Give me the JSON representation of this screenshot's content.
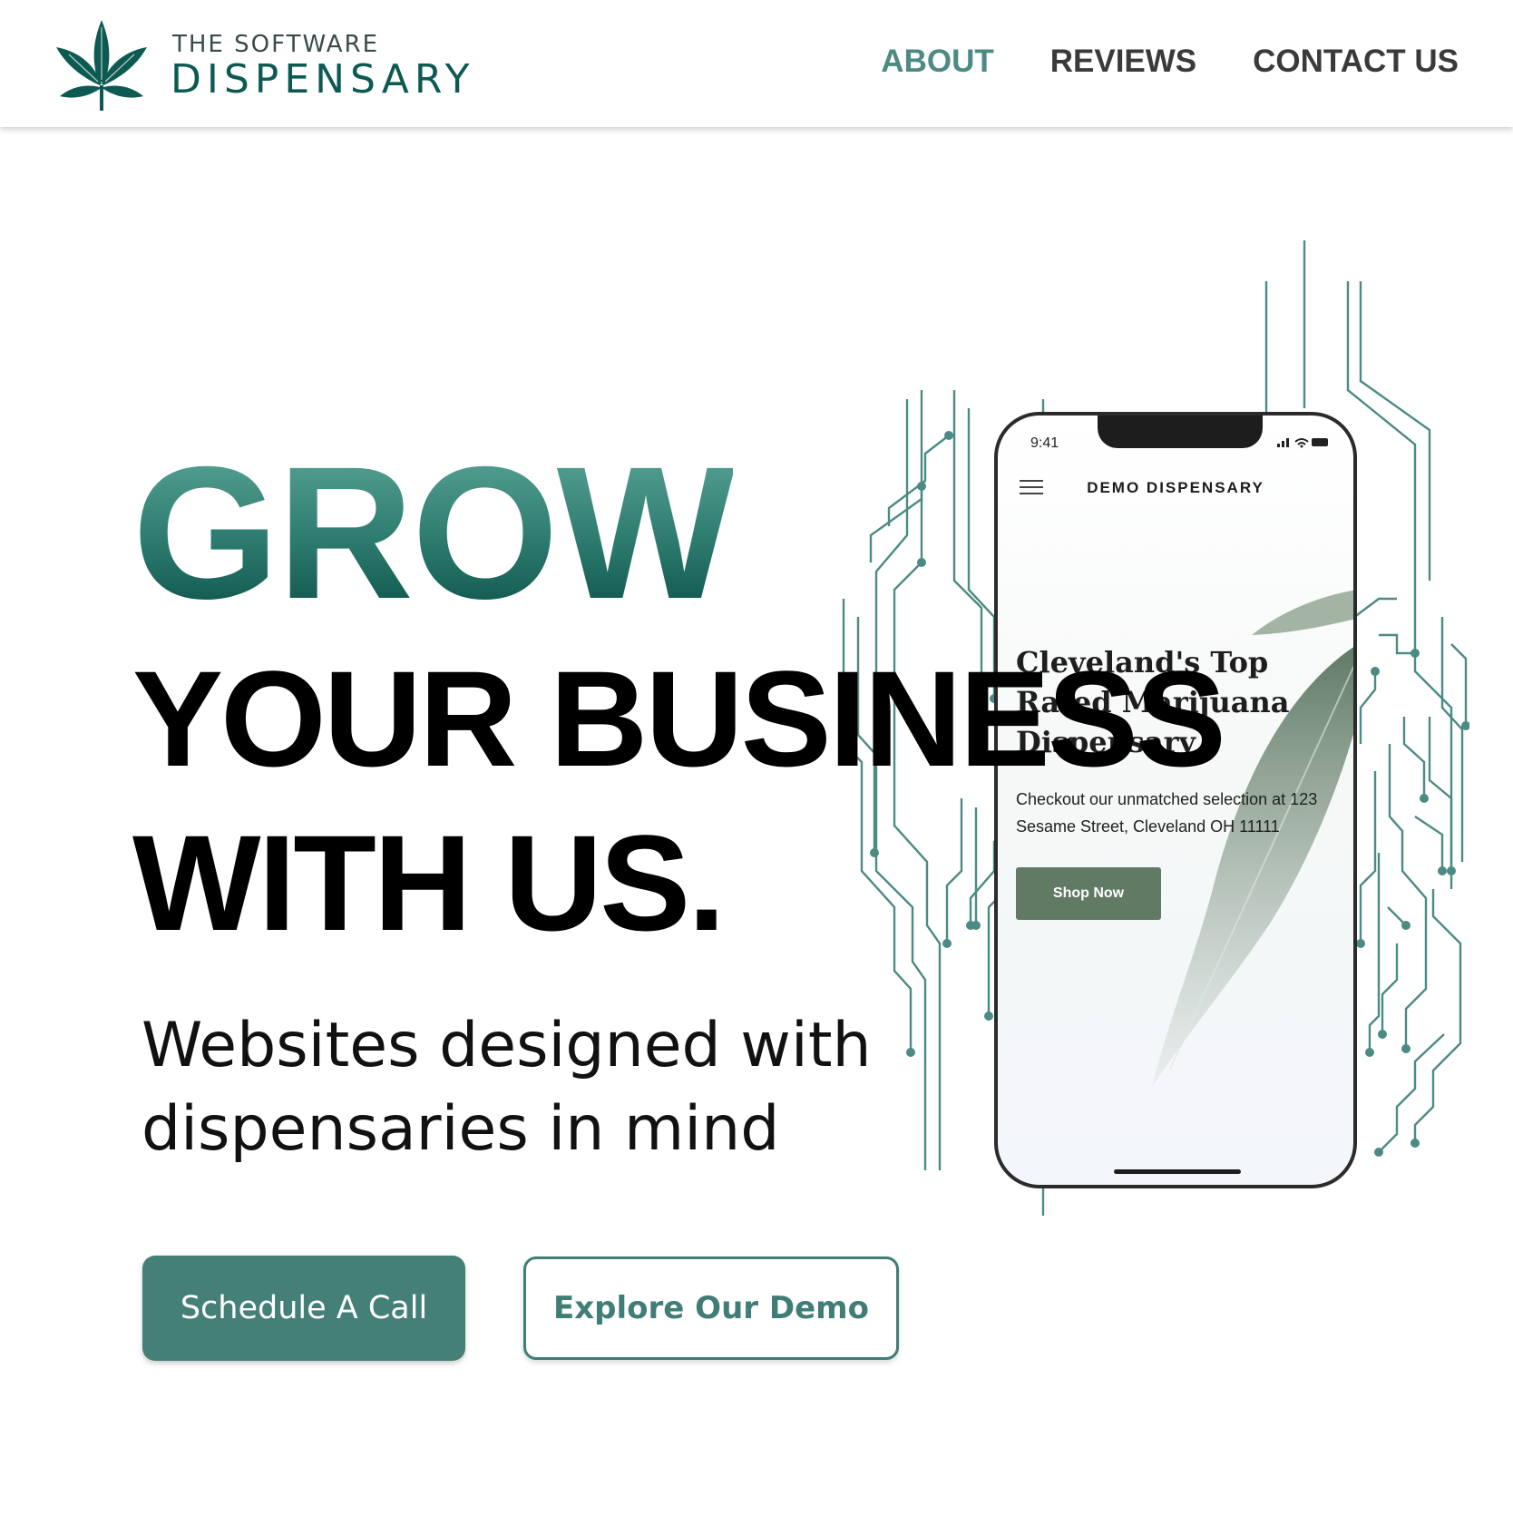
{
  "brand": {
    "line1": "THE SOFTWARE",
    "line2": "DISPENSARY",
    "logo_icon": "cannabis-leaf-icon"
  },
  "nav": {
    "items": [
      {
        "label": "ABOUT",
        "active": true
      },
      {
        "label": "REVIEWS",
        "active": false
      },
      {
        "label": "CONTACT US",
        "active": false
      }
    ]
  },
  "hero": {
    "headline_grow": "GROW",
    "headline_line2": "YOUR BUSINESS",
    "headline_line3": "WITH US.",
    "subtitle": "Websites designed with dispensaries in mind",
    "primary_button": "Schedule A Call",
    "secondary_button": "Explore Our Demo"
  },
  "phone": {
    "time": "9:41",
    "app_title": "DEMO DISPENSARY",
    "headline": "Cleveland's Top Rated Marijuana Dispensary",
    "description": "Checkout our unmatched selection at 123 Sesame Street, Cleveland OH 11111",
    "shop_button": "Shop Now"
  },
  "colors": {
    "accent": "#447f78",
    "brand_dark": "#0d5a52",
    "nav_active": "#4c8a84",
    "shop_button": "#617a64"
  }
}
